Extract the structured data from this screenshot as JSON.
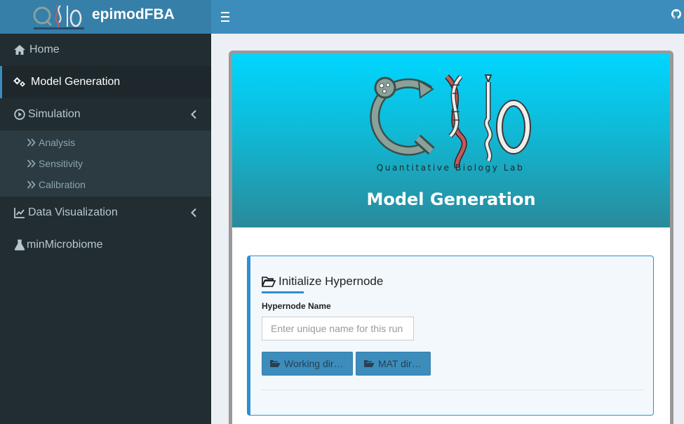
{
  "app": {
    "title": "epimodFBA"
  },
  "sidebar": {
    "items": [
      {
        "label": "Home",
        "icon": "home-icon"
      },
      {
        "label": "Model Generation",
        "icon": "cogs-icon",
        "active": true
      },
      {
        "label": "Simulation",
        "icon": "play-circle-icon",
        "expanded": true,
        "children": [
          {
            "label": "Analysis",
            "icon": "double-chevron-right-icon"
          },
          {
            "label": "Sensitivity",
            "icon": "double-chevron-right-icon"
          },
          {
            "label": "Calibration",
            "icon": "double-chevron-right-icon"
          }
        ]
      },
      {
        "label": "Data Visualization",
        "icon": "line-chart-icon"
      },
      {
        "label": "minMicrobiome",
        "icon": "flask-icon"
      }
    ]
  },
  "hero": {
    "logo_caption": "Quantitative Biology Lab",
    "title": "Model Generation"
  },
  "panel": {
    "title": "Initialize Hypernode",
    "field_label": "Hypernode Name",
    "field_placeholder": "Enter unique name for this run",
    "field_value": "",
    "buttons": [
      {
        "label": "Working dir…"
      },
      {
        "label": "MAT dir…"
      }
    ]
  },
  "colors": {
    "header": "#3c8dbc",
    "brand": "#367fa9",
    "sidebar": "#222d32",
    "accent": "#2f8fd0",
    "hero_top": "#00d6ff",
    "hero_bottom": "#2a8a9a"
  }
}
